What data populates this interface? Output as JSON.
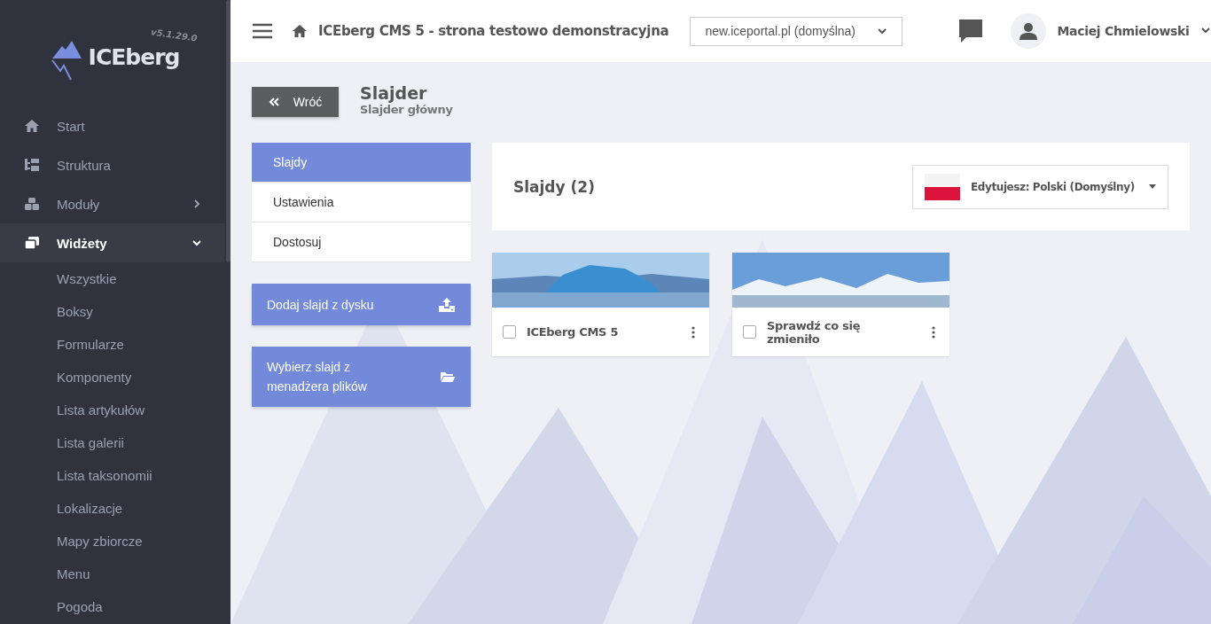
{
  "sidebar": {
    "logo": "ICEberg",
    "version": "v5.1.29.0",
    "items": [
      {
        "label": "Start",
        "selected": false
      },
      {
        "label": "Struktura",
        "selected": false
      },
      {
        "label": "Moduły",
        "selected": false,
        "expanded": false
      },
      {
        "label": "Widżety",
        "selected": true,
        "expanded": true,
        "children": [
          {
            "label": "Wszystkie"
          },
          {
            "label": "Boksy"
          },
          {
            "label": "Formularze"
          },
          {
            "label": "Komponenty"
          },
          {
            "label": "Lista artykułów"
          },
          {
            "label": "Lista galerii"
          },
          {
            "label": "Lista taksonomii"
          },
          {
            "label": "Lokalizacje"
          },
          {
            "label": "Mapy zbiorcze"
          },
          {
            "label": "Menu"
          },
          {
            "label": "Pogoda"
          }
        ]
      }
    ]
  },
  "topbar": {
    "title": "ICEberg CMS 5 - strona testowo demonstracyjna",
    "domain": "new.iceportal.pl (domyślna)",
    "user": "Maciej Chmielowski"
  },
  "header": {
    "back": "Wróć",
    "title": "Slajder",
    "subtitle": "Slajder główny"
  },
  "tabs": [
    {
      "label": "Slajdy",
      "selected": true
    },
    {
      "label": "Ustawienia",
      "selected": false
    },
    {
      "label": "Dostosuj",
      "selected": false
    }
  ],
  "actions": [
    {
      "label": "Dodaj slajd z dysku"
    },
    {
      "label": "Wybierz slajd z menadżera plików"
    }
  ],
  "panel": {
    "title": "Slajdy (2)",
    "language": "Edytujesz: Polski (Domyślny)"
  },
  "slides": [
    {
      "title": "ICEberg CMS 5",
      "checked": false
    },
    {
      "title": "Sprawdź co się zmieniło",
      "checked": false
    }
  ]
}
